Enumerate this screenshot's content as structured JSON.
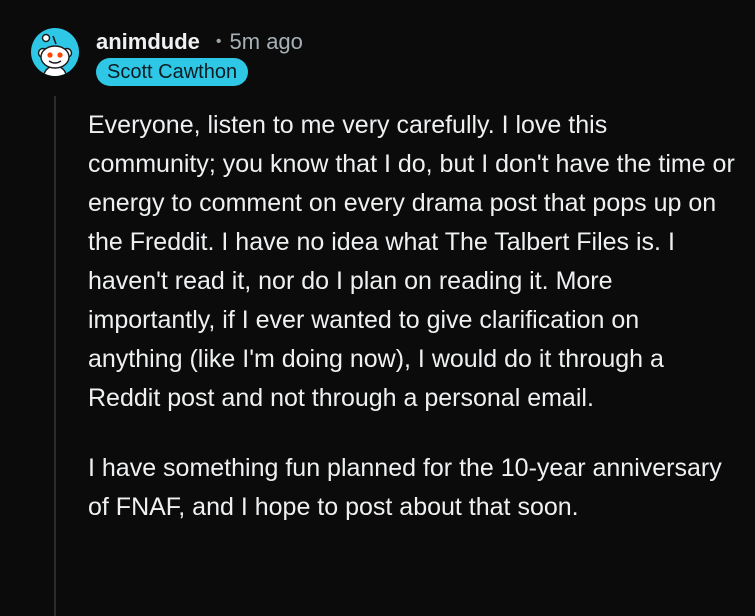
{
  "comment": {
    "author": "animdude",
    "separator": "•",
    "timestamp": "5m ago",
    "flair": "Scott Cawthon",
    "avatar_icon": "reddit-snoo-icon",
    "colors": {
      "background": "#0b0b0b",
      "avatar": "#2ec7e6",
      "flair_background": "#2ec7e6",
      "flair_text": "#0c1c22",
      "text": "#eef0f2",
      "meta_text": "#a7b0b5"
    },
    "paragraphs": [
      "Everyone, listen to me very carefully. I love this community; you know that I do, but I don't have the time or energy to comment on every drama post that pops up on the Freddit. I have no idea what The Talbert Files is. I haven't read it, nor do I plan on reading it. More importantly, if I ever wanted to give clarification on anything (like I'm doing now), I would do it through a Reddit post and not through a personal email.",
      "I have something fun planned for the 10-year anniversary of FNAF, and I hope to post about that soon."
    ]
  }
}
